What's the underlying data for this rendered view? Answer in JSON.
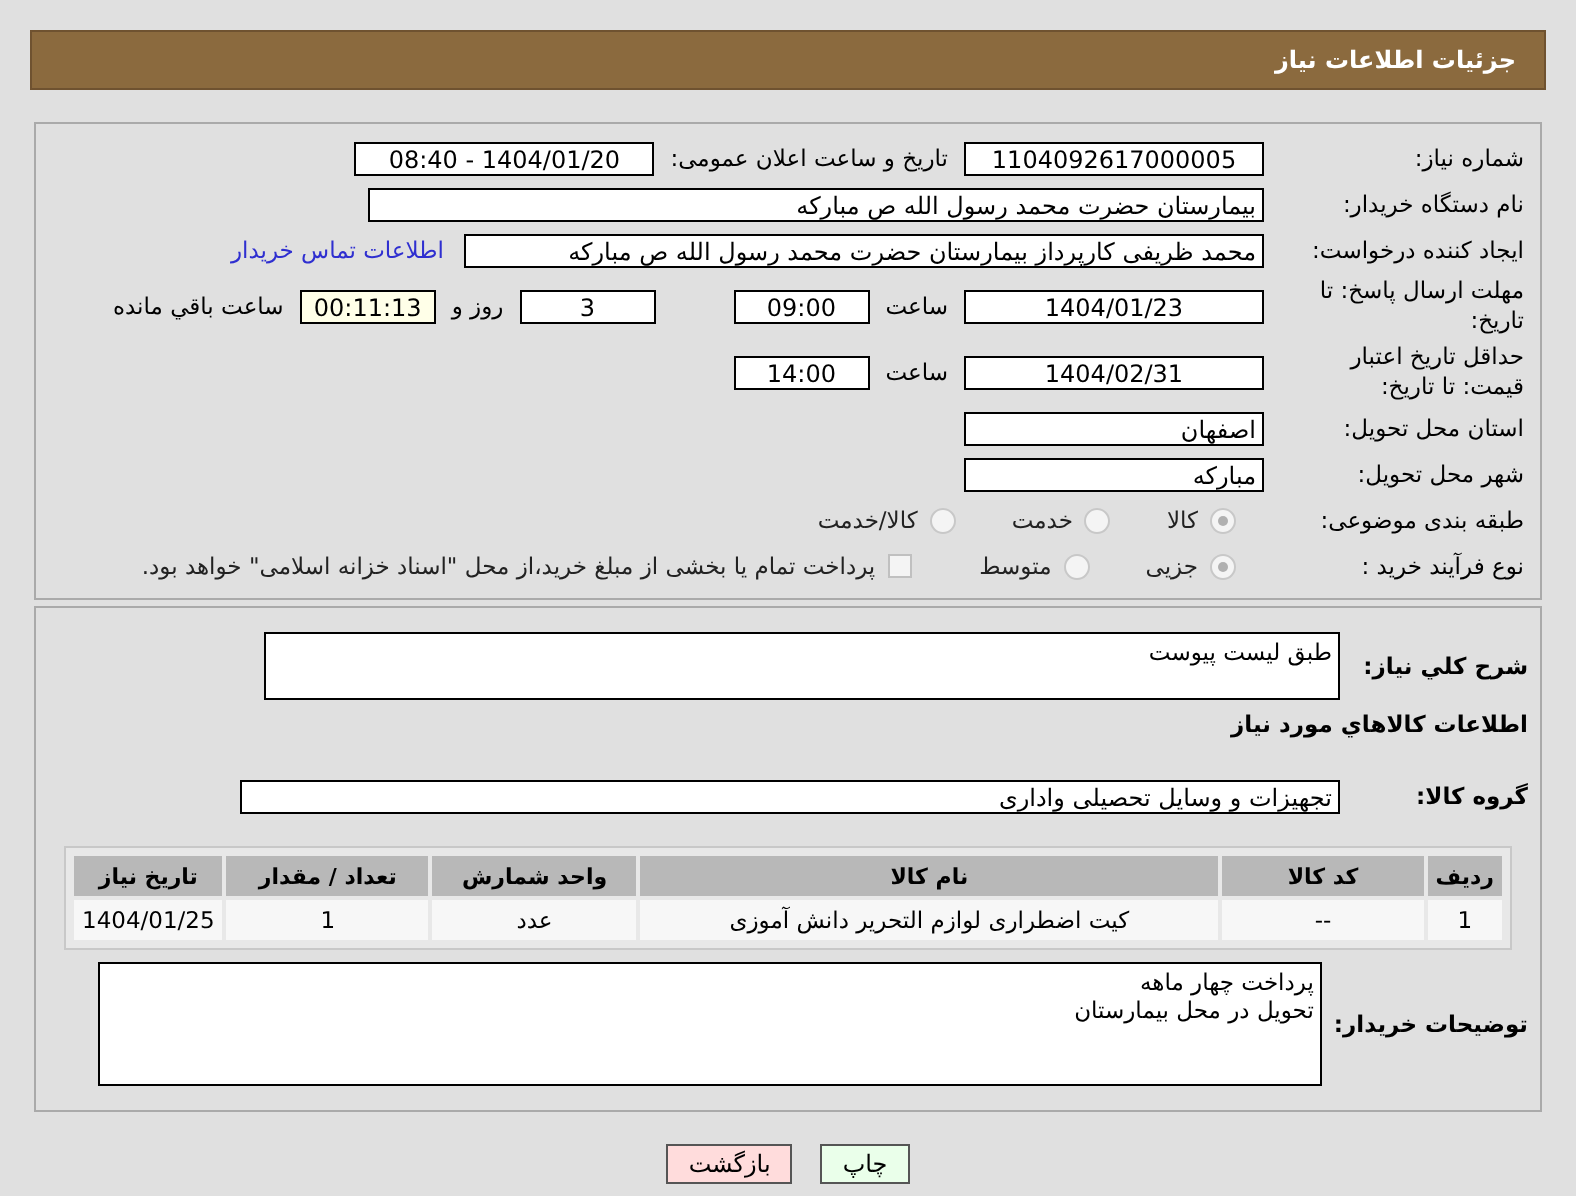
{
  "header": {
    "title": "جزئیات اطلاعات نیاز"
  },
  "details": {
    "need_number": {
      "label": "شماره نیاز:",
      "value": "1104092617000005"
    },
    "announce": {
      "label": "تاریخ و ساعت اعلان عمومی:",
      "value": "1404/01/20 - 08:40"
    },
    "buyer": {
      "label": "نام دستگاه خریدار:",
      "value": "بیمارستان حضرت محمد رسول الله  ص  مبارکه"
    },
    "creator": {
      "label": "ایجاد کننده درخواست:",
      "value": "محمد ظریفی کارپرداز بیمارستان حضرت محمد رسول الله  ص  مبارکه",
      "link": "اطلاعات تماس خریدار"
    },
    "deadline": {
      "label": "مهلت ارسال پاسخ: تا تاریخ:",
      "date": "1404/01/23",
      "time_label": "ساعت",
      "time": "09:00",
      "days": "3",
      "days_label": "روز و",
      "remaining": "00:11:13",
      "remaining_label": "ساعت باقي مانده"
    },
    "validity": {
      "label": "حداقل تاریخ اعتبار قیمت: تا تاریخ:",
      "date": "1404/02/31",
      "time_label": "ساعت",
      "time": "14:00"
    },
    "province": {
      "label": "استان محل تحویل:",
      "value": "اصفهان"
    },
    "city": {
      "label": "شهر محل تحویل:",
      "value": "مبارکه"
    },
    "category": {
      "label": "طبقه بندی موضوعی:",
      "options": [
        {
          "label": "کالا",
          "selected": true
        },
        {
          "label": "خدمت",
          "selected": false
        },
        {
          "label": "کالا/خدمت",
          "selected": false
        }
      ]
    },
    "process": {
      "label": "نوع فرآیند خرید :",
      "options": [
        {
          "label": "جزیی",
          "selected": true
        },
        {
          "label": "متوسط",
          "selected": false
        }
      ],
      "treasury": {
        "label": "پرداخت تمام یا بخشی از مبلغ خرید،از محل \"اسناد خزانه اسلامی\" خواهد بود.",
        "checked": false
      }
    }
  },
  "need": {
    "description_label": "شرح كلي نیاز:",
    "description": "طبق لیست پیوست",
    "goods_title": "اطلاعات كالاهاي مورد نياز",
    "group_label": "گروه کالا:",
    "group": "تجهیزات و وسایل تحصیلی واداری",
    "table": {
      "columns": [
        "ردیف",
        "کد کالا",
        "نام کالا",
        "واحد شمارش",
        "تعداد / مقدار",
        "تاریخ نیاز"
      ],
      "rows": [
        [
          "1",
          "--",
          "کیت اضطراری لوازم التحریر دانش آموزی",
          "عدد",
          "1",
          "1404/01/25"
        ]
      ]
    },
    "notes_label": "توضیحات خریدار:",
    "notes": [
      "پرداخت چهار ماهه",
      "تحویل در محل بیمارستان"
    ]
  },
  "buttons": [
    {
      "kind": "print",
      "label": "چاپ"
    },
    {
      "kind": "back",
      "label": "بازگشت"
    }
  ]
}
